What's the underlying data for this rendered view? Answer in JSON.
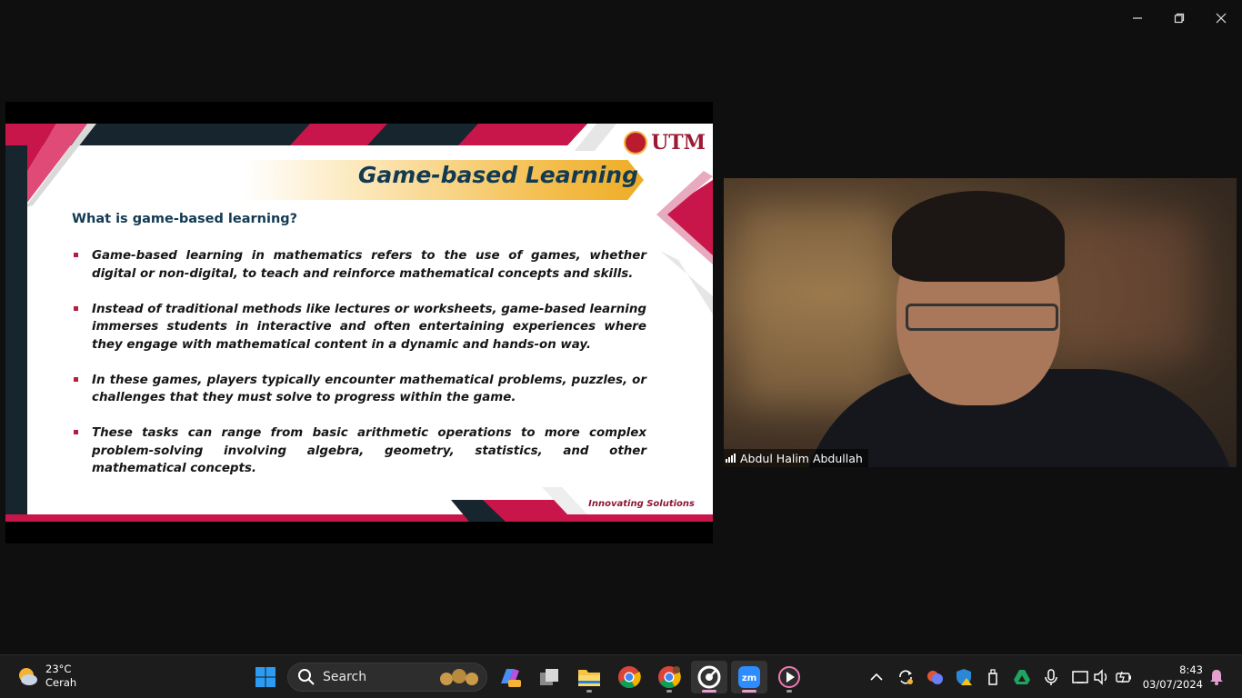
{
  "window": {
    "controls": [
      "minimize-icon",
      "restore-icon",
      "close-icon"
    ]
  },
  "slide": {
    "title": "Game-based Learning",
    "logo_text": "UTM",
    "question": "What is game-based learning?",
    "bullets": [
      "Game-based learning in mathematics refers to the use of games, whether digital or non-digital, to teach and reinforce mathematical concepts and skills.",
      "Instead of traditional methods like lectures or worksheets, game-based learning immerses students in interactive and often entertaining experiences where they engage with mathematical content in a dynamic and hands-on way.",
      "In these games, players typically encounter mathematical problems, puzzles, or challenges that they must solve to progress within the game.",
      "These tasks can range from basic arithmetic operations to more complex problem-solving involving algebra, geometry, statistics, and other mathematical concepts."
    ],
    "tagline": "Innovating Solutions",
    "colors": {
      "accent": "#c8164a",
      "navy": "#123a52",
      "gold": "#eeac25"
    }
  },
  "video": {
    "participant_name": "Abdul Halim Abdullah",
    "signal_icon": "signal-bars-icon"
  },
  "taskbar": {
    "weather": {
      "temp": "23°C",
      "condition": "Cerah",
      "icon": "partly-cloudy-icon"
    },
    "search": {
      "label": "Search"
    },
    "apps": [
      "start-icon",
      "copilot-icon",
      "task-view-icon",
      "file-explorer-icon",
      "chrome-icon",
      "chrome-profile-icon",
      "app-icon",
      "zoom-icon",
      "media-player-icon"
    ],
    "tray": [
      "chevron-up-icon",
      "sync-icon",
      "app-tray-icon",
      "defender-icon",
      "usb-icon",
      "drive-icon",
      "microphone-icon",
      "display-icon",
      "volume-icon",
      "battery-icon"
    ],
    "clock": {
      "time": "8:43",
      "date": "03/07/2024"
    },
    "notification_icon": "bell-icon"
  }
}
